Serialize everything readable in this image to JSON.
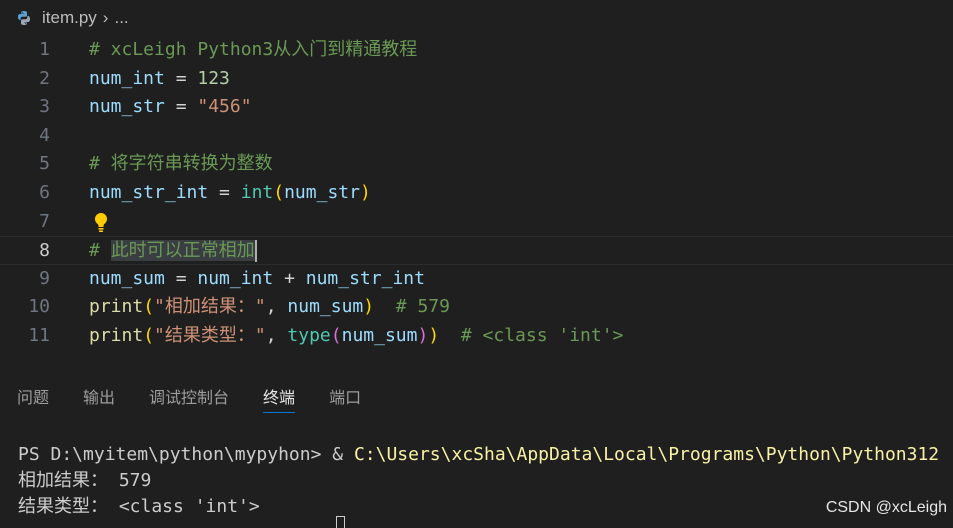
{
  "breadcrumb": {
    "file": "item.py",
    "separator": "›",
    "ellipsis": "..."
  },
  "editor": {
    "lines": [
      {
        "num": "1",
        "tokens": [
          {
            "t": "cm",
            "v": "# xcLeigh Python3从入门到精通教程"
          }
        ]
      },
      {
        "num": "2",
        "tokens": [
          {
            "t": "vr",
            "v": "num_int"
          },
          {
            "t": "op",
            "v": " = "
          },
          {
            "t": "nm",
            "v": "123"
          }
        ]
      },
      {
        "num": "3",
        "tokens": [
          {
            "t": "vr",
            "v": "num_str"
          },
          {
            "t": "op",
            "v": " = "
          },
          {
            "t": "st",
            "v": "\"456\""
          }
        ]
      },
      {
        "num": "4",
        "tokens": []
      },
      {
        "num": "5",
        "tokens": [
          {
            "t": "cm",
            "v": "# 将字符串转换为整数"
          }
        ]
      },
      {
        "num": "6",
        "tokens": [
          {
            "t": "vr",
            "v": "num_str_int"
          },
          {
            "t": "op",
            "v": " = "
          },
          {
            "t": "bt",
            "v": "int"
          },
          {
            "t": "br1",
            "v": "("
          },
          {
            "t": "vr",
            "v": "num_str"
          },
          {
            "t": "br1",
            "v": ")"
          }
        ]
      },
      {
        "num": "7",
        "tokens": []
      },
      {
        "num": "8",
        "tokens": [
          {
            "t": "cm",
            "v": "# "
          },
          {
            "t": "cm sel",
            "v": "此时可以正常相加"
          }
        ]
      },
      {
        "num": "9",
        "tokens": [
          {
            "t": "vr",
            "v": "num_sum"
          },
          {
            "t": "op",
            "v": " = "
          },
          {
            "t": "vr",
            "v": "num_int"
          },
          {
            "t": "op",
            "v": " + "
          },
          {
            "t": "vr",
            "v": "num_str_int"
          }
        ]
      },
      {
        "num": "10",
        "tokens": [
          {
            "t": "fn",
            "v": "print"
          },
          {
            "t": "br1",
            "v": "("
          },
          {
            "t": "st",
            "v": "\"相加结果：\""
          },
          {
            "t": "op",
            "v": ", "
          },
          {
            "t": "vr",
            "v": "num_sum"
          },
          {
            "t": "br1",
            "v": ")"
          },
          {
            "t": "op",
            "v": "  "
          },
          {
            "t": "cm",
            "v": "# 579"
          }
        ]
      },
      {
        "num": "11",
        "tokens": [
          {
            "t": "fn",
            "v": "print"
          },
          {
            "t": "br1",
            "v": "("
          },
          {
            "t": "st",
            "v": "\"结果类型：\""
          },
          {
            "t": "op",
            "v": ", "
          },
          {
            "t": "bt",
            "v": "type"
          },
          {
            "t": "br2",
            "v": "("
          },
          {
            "t": "vr",
            "v": "num_sum"
          },
          {
            "t": "br2",
            "v": ")"
          },
          {
            "t": "br1",
            "v": ")"
          },
          {
            "t": "op",
            "v": "  "
          },
          {
            "t": "cm",
            "v": "# <class 'int'>"
          }
        ]
      }
    ],
    "active_line": "8",
    "lightbulb_line": "7"
  },
  "panel": {
    "tabs": [
      {
        "label": "问题",
        "active": false
      },
      {
        "label": "输出",
        "active": false
      },
      {
        "label": "调试控制台",
        "active": false
      },
      {
        "label": "终端",
        "active": true
      },
      {
        "label": "端口",
        "active": false
      }
    ]
  },
  "terminal": {
    "prompt": "PS D:\\myitem\\python\\mypyhon> & ",
    "command": "C:\\Users\\xcSha\\AppData\\Local\\Programs\\Python\\Python312",
    "output": [
      "相加结果： 579",
      "结果类型： <class 'int'>"
    ]
  },
  "watermark": "CSDN @xcLeigh",
  "colors": {
    "background": "#1f1f1f",
    "comment": "#6a9955",
    "variable": "#9cdcfe",
    "number": "#b5cea8",
    "string": "#ce9178",
    "function": "#dcdcaa",
    "builtin": "#4ec9b0",
    "bracket1": "#ffd700",
    "bracket2": "#da70d6",
    "tab_active_underline": "#0078d4",
    "terminal_command": "#f9f1a5"
  }
}
